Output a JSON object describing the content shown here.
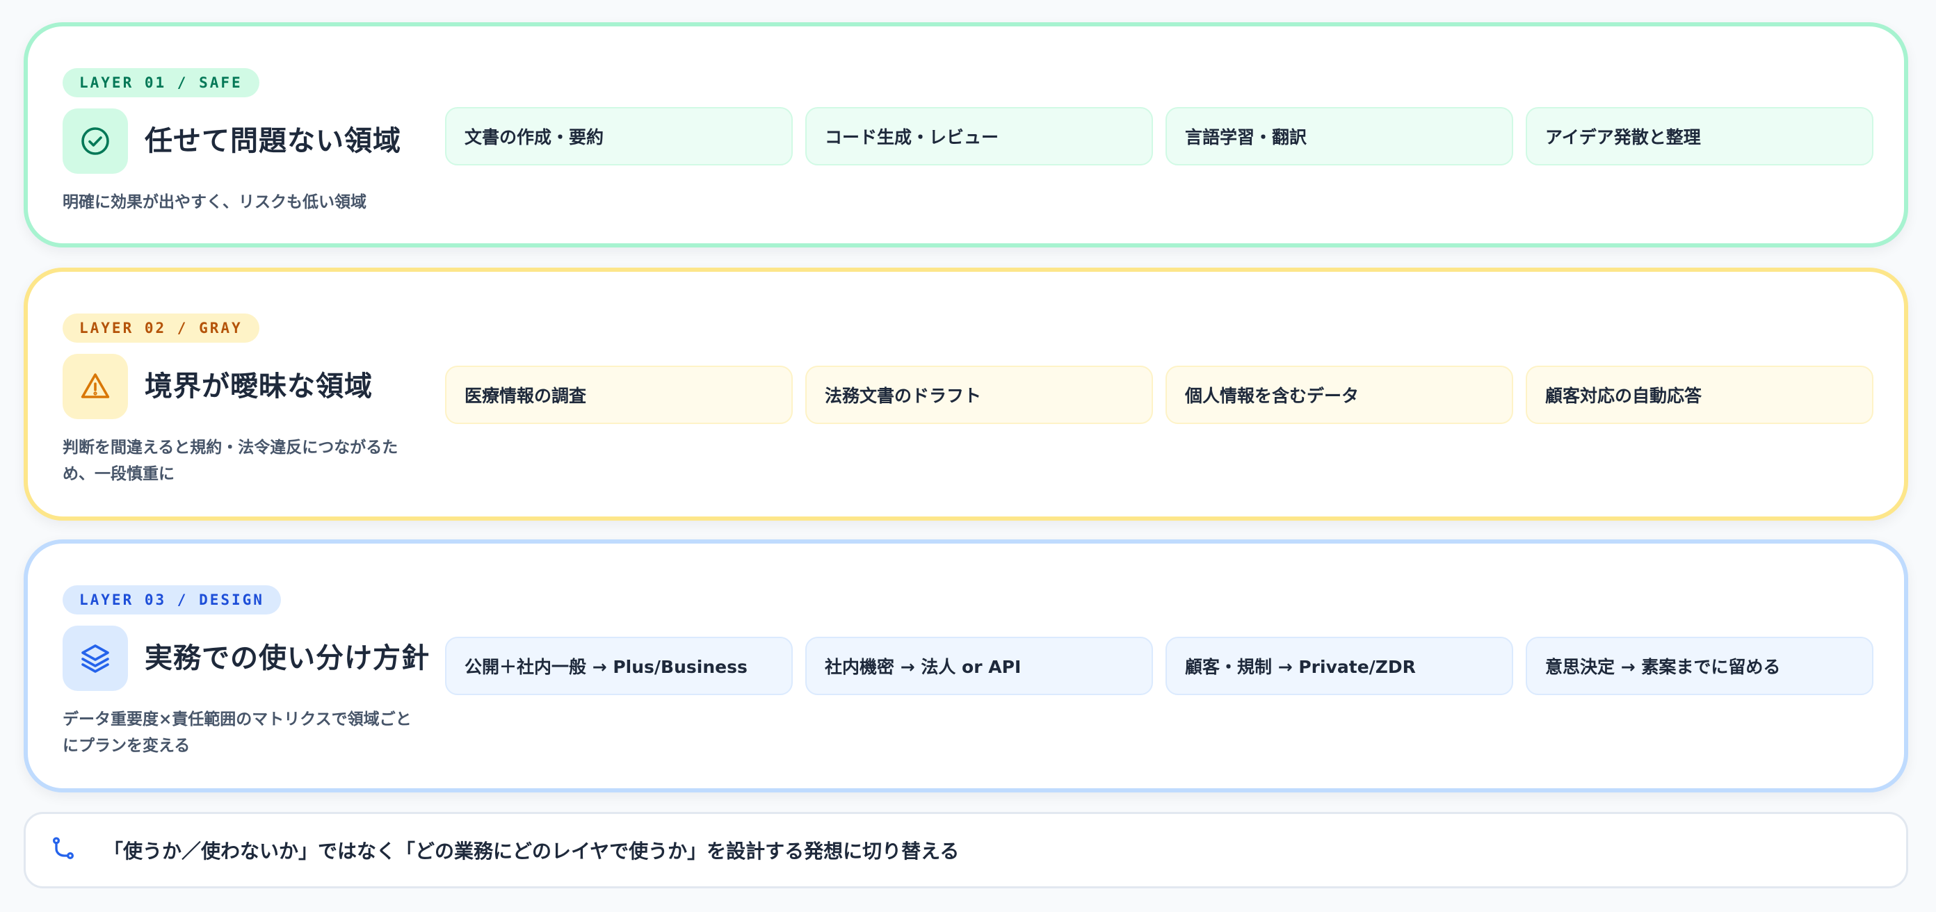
{
  "colors": {
    "safe_border": "#a7f3d0",
    "gray_border": "#fde68a",
    "design_border": "#bfdbfe",
    "safe_accent": "#047857",
    "gray_accent": "#d97706",
    "design_accent": "#2563eb"
  },
  "layers": [
    {
      "badge": "LAYER 01 / SAFE",
      "icon": "check-circle-icon",
      "title": "任せて問題ない領域",
      "description": "明確に効果が出やすく、リスクも低い領域",
      "chips": [
        "文書の作成・要約",
        "コード生成・レビュー",
        "言語学習・翻訳",
        "アイデア発散と整理"
      ]
    },
    {
      "badge": "LAYER 02 / GRAY",
      "icon": "warning-triangle-icon",
      "title": "境界が曖昧な領域",
      "description": "判断を間違えると規約・法令違反につながるため、一段慎重に",
      "chips": [
        "医療情報の調査",
        "法務文書のドラフト",
        "個人情報を含むデータ",
        "顧客対応の自動応答"
      ]
    },
    {
      "badge": "LAYER 03 / DESIGN",
      "icon": "layers-icon",
      "title": "実務での使い分け方針",
      "description": "データ重要度×責任範囲のマトリクスで領域ごとにプランを変える",
      "chips": [
        "公開＋社内一般 → Plus/Business",
        "社内機密 → 法人 or API",
        "顧客・規制 → Private/ZDR",
        "意思決定 → 素案までに留める"
      ]
    }
  ],
  "footer": {
    "icon": "git-branch-icon",
    "text": "「使うか／使わないか」ではなく「どの業務にどのレイヤで使うか」を設計する発想に切り替える"
  }
}
